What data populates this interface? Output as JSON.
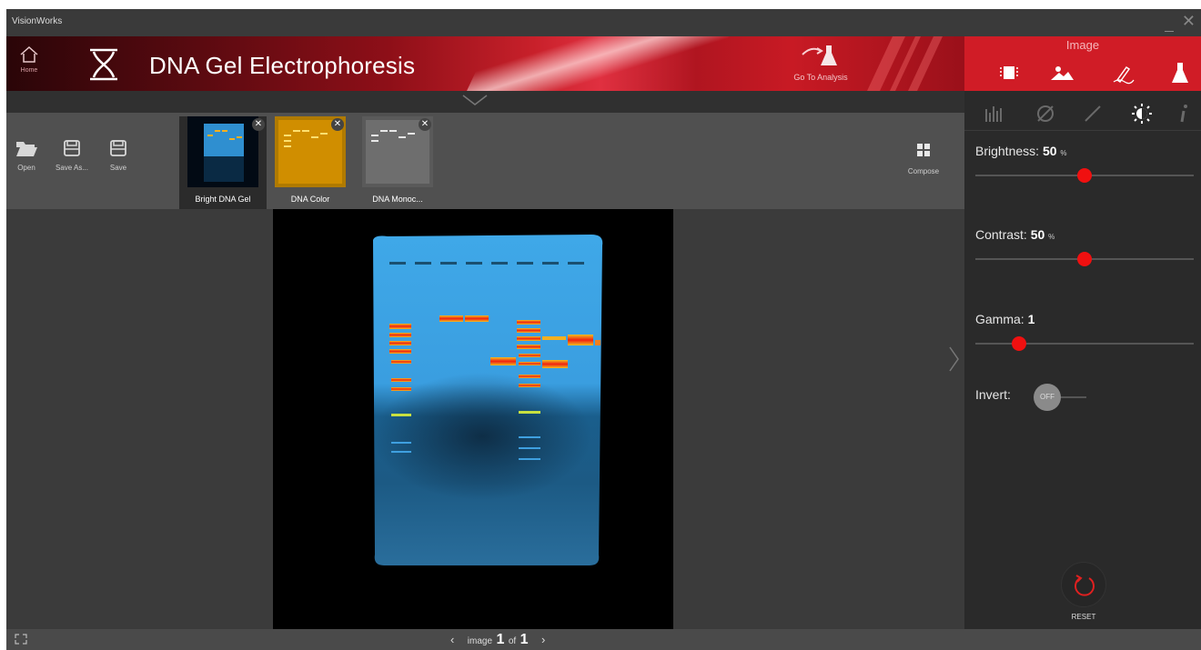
{
  "window": {
    "title": "VisionWorks"
  },
  "header": {
    "home_label": "Home",
    "title": "DNA Gel Electrophoresis",
    "go_to_analysis_label": "Go To Analysis",
    "tab_label": "Image"
  },
  "toolbar": {
    "open_label": "Open",
    "save_as_label": "Save As...",
    "save_label": "Save",
    "compose_label": "Compose",
    "thumbnails": [
      {
        "name": "Bright DNA Gel",
        "selected": true
      },
      {
        "name": "DNA Color",
        "selected": false
      },
      {
        "name": "DNA Monoc...",
        "selected": false
      }
    ]
  },
  "adjust": {
    "brightness": {
      "label": "Brightness:",
      "value": "50",
      "unit": "%",
      "fraction": 0.5
    },
    "contrast": {
      "label": "Contrast:",
      "value": "50",
      "unit": "%",
      "fraction": 0.5
    },
    "gamma": {
      "label": "Gamma:",
      "value": "1",
      "fraction": 0.2
    },
    "invert": {
      "label": "Invert:",
      "state": "OFF"
    },
    "reset_label": "RESET"
  },
  "pager": {
    "prefix": "image",
    "current": "1",
    "separator": "of",
    "total": "1"
  },
  "icons": {
    "home": "home-icon",
    "logo": "dna-logo-icon",
    "analysis": "flask-icon",
    "panel_tools": [
      "histogram-icon",
      "filter-icon",
      "pen-icon",
      "brightness-icon",
      "info-icon"
    ]
  },
  "colors": {
    "accent_red": "#d01c26",
    "slider_red": "#f01010"
  }
}
